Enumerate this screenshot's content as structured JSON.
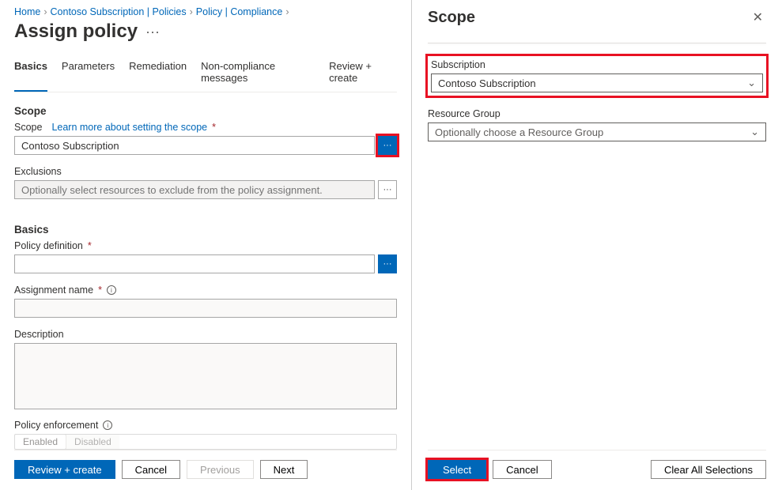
{
  "breadcrumb": {
    "items": [
      "Home",
      "Contoso Subscription | Policies",
      "Policy | Compliance"
    ]
  },
  "page": {
    "title": "Assign policy"
  },
  "tabs": [
    {
      "label": "Basics",
      "active": true
    },
    {
      "label": "Parameters",
      "active": false
    },
    {
      "label": "Remediation",
      "active": false
    },
    {
      "label": "Non-compliance messages",
      "active": false
    },
    {
      "label": "Review + create",
      "active": false
    }
  ],
  "scope_section": {
    "header": "Scope",
    "scope_label": "Scope",
    "learn_more": "Learn more about setting the scope",
    "scope_value": "Contoso Subscription",
    "exclusions_label": "Exclusions",
    "exclusions_placeholder": "Optionally select resources to exclude from the policy assignment."
  },
  "basics_section": {
    "header": "Basics",
    "policy_def_label": "Policy definition",
    "assignment_name_label": "Assignment name",
    "assignment_name_value": "",
    "description_label": "Description",
    "description_value": "",
    "policy_enforcement_label": "Policy enforcement",
    "enabled_label": "Enabled",
    "disabled_label": "Disabled"
  },
  "footer": {
    "review_create": "Review + create",
    "cancel": "Cancel",
    "previous": "Previous",
    "next": "Next"
  },
  "panel": {
    "title": "Scope",
    "subscription_label": "Subscription",
    "subscription_value": "Contoso Subscription",
    "resource_group_label": "Resource Group",
    "resource_group_placeholder": "Optionally choose a Resource Group",
    "select": "Select",
    "cancel": "Cancel",
    "clear": "Clear All Selections"
  }
}
